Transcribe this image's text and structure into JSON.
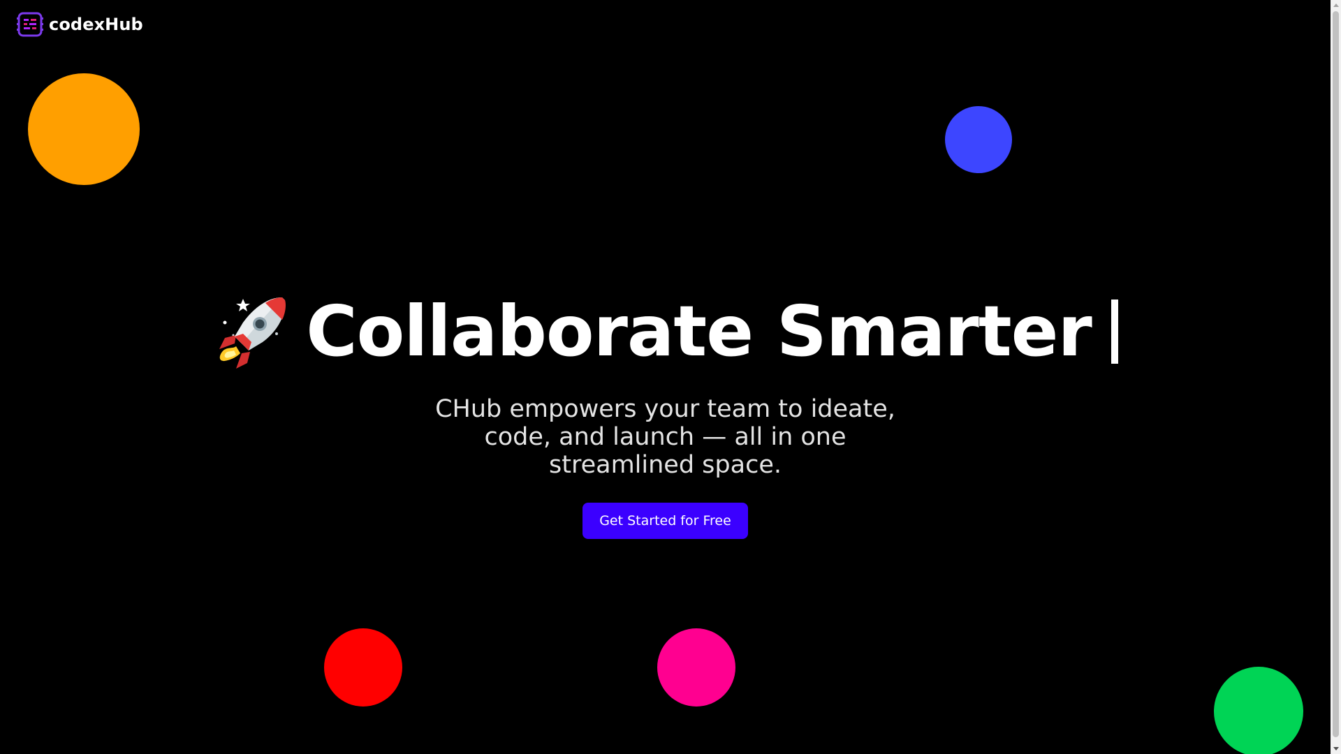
{
  "brand": {
    "name": "codexHub",
    "logo_icon": "codex-logo-icon",
    "logo_color": "#7c3aed"
  },
  "hero": {
    "emoji_icon": "rocket-icon",
    "headline": "Collaborate Smarter",
    "subtext": "CHub empowers your team to ideate, code, and launch — all in one streamlined space.",
    "cta_label": "Get Started for Free",
    "cta_color": "#3b00ff"
  },
  "decorations": {
    "circle_colors": [
      "#ff9f00",
      "#3d46ff",
      "#ff0000",
      "#ff0090",
      "#00d455"
    ]
  }
}
